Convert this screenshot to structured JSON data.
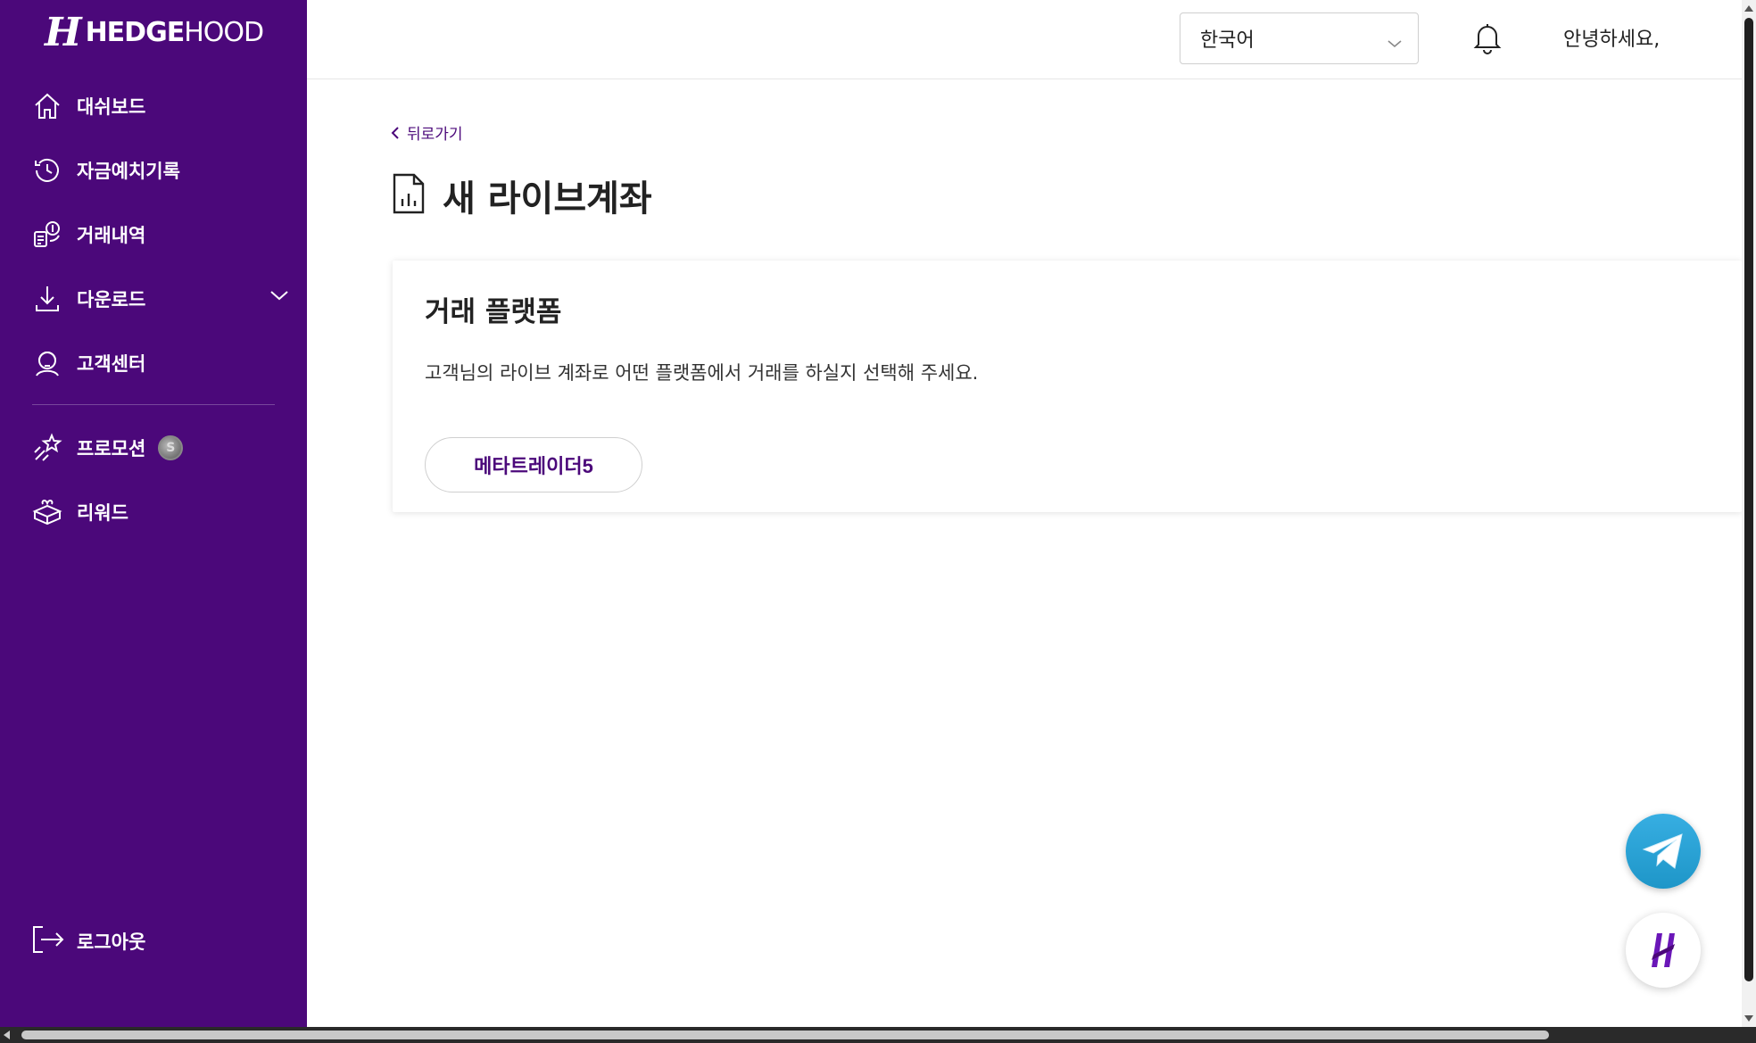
{
  "brand": {
    "logo_mark": "H",
    "logo_word_bold": "HEDGE",
    "logo_word_light": "HOOD"
  },
  "sidebar": {
    "items": [
      {
        "label": "대쉬보드",
        "icon": "home-icon"
      },
      {
        "label": "자금예치기록",
        "icon": "history-icon"
      },
      {
        "label": "거래내역",
        "icon": "transactions-icon"
      },
      {
        "label": "다운로드",
        "icon": "download-icon",
        "expandable": true
      },
      {
        "label": "고객센터",
        "icon": "support-icon"
      },
      {
        "label": "프로모션",
        "icon": "stars-icon",
        "badge_icon": "coin-icon"
      },
      {
        "label": "리워드",
        "icon": "gift-box-icon"
      }
    ],
    "logout_label": "로그아웃"
  },
  "header": {
    "language": "한국어",
    "greeting": "안녕하세요,"
  },
  "main": {
    "back_label": "뒤로가기",
    "page_title": "새 라이브계좌",
    "card": {
      "title": "거래 플랫폼",
      "description": "고객님의 라이브 계좌로 어떤 플랫폼에서 거래를 하실지 선택해 주세요.",
      "platform_button": "메타트레이더5"
    }
  },
  "colors": {
    "brand_purple": "#4b087a",
    "telegram_blue": "#2aa3d9"
  }
}
